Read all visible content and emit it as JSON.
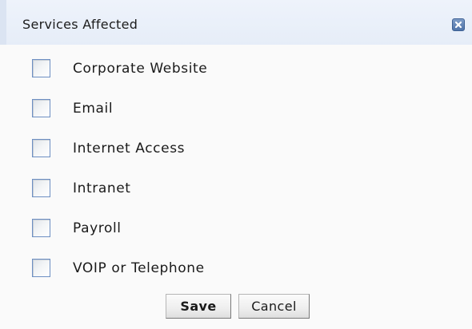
{
  "dialog": {
    "title": "Services Affected",
    "close_icon": "close-icon",
    "colors": {
      "header_background": "#e6edf8",
      "close_button": "#4f73a8",
      "checkbox_border": "#6d8fc3"
    }
  },
  "services": [
    {
      "label": "Corporate Website",
      "checked": false
    },
    {
      "label": "Email",
      "checked": false
    },
    {
      "label": "Internet Access",
      "checked": false
    },
    {
      "label": "Intranet",
      "checked": false
    },
    {
      "label": "Payroll",
      "checked": false
    },
    {
      "label": "VOIP or Telephone",
      "checked": false
    }
  ],
  "buttons": {
    "save_label": "Save",
    "cancel_label": "Cancel"
  }
}
